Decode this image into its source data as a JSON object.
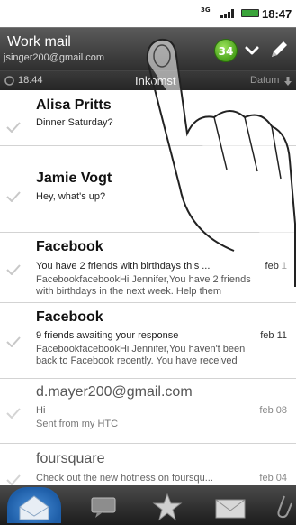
{
  "status_bar": {
    "network": "3G",
    "time": "18:47"
  },
  "header": {
    "account_name": "Work mail",
    "account_email": "jsinger200@gmail.com",
    "unread_count": "34"
  },
  "sortbar": {
    "sync_time": "18:44",
    "folder": "Inkomst",
    "sort_label": "Datum"
  },
  "emails": [
    {
      "sender": "Alisa Pritts",
      "subject": "Dinner Saturday?",
      "preview": "",
      "date": "",
      "read": false
    },
    {
      "sender": "Jamie Vogt",
      "subject": "Hey, what's up?",
      "preview": "",
      "date": "",
      "read": false
    },
    {
      "sender": "Facebook",
      "subject": "You have 2 friends with birthdays this ...",
      "preview": "FacebookfacebookHi Jennifer,You have 2 friends with birthdays in the next week. Help them",
      "date": "feb 1",
      "read": false
    },
    {
      "sender": "Facebook",
      "subject": "9 friends awaiting your response",
      "preview": "FacebookfacebookHi Jennifer,You haven't been back to Facebook recently. You have received",
      "date": "feb 11",
      "read": false
    },
    {
      "sender": "d.mayer200@gmail.com",
      "subject": "Hi",
      "preview": "Sent from my HTC",
      "date": "feb 08",
      "read": true
    },
    {
      "sender": "foursquare",
      "subject": "Check out the new hotness on foursqu...",
      "preview": "",
      "date": "feb 04",
      "read": true
    }
  ],
  "tabs": [
    {
      "name": "tab-inbox",
      "icon": "envelope-open-icon"
    },
    {
      "name": "tab-conversations",
      "icon": "chat-bubbles-icon"
    },
    {
      "name": "tab-favorites",
      "icon": "star-icon"
    },
    {
      "name": "tab-unread",
      "icon": "envelope-icon"
    },
    {
      "name": "tab-more",
      "icon": "paperclip-icon"
    }
  ],
  "colors": {
    "header_bg": "#3f3f3f",
    "badge": "#5cb82a",
    "active_tab": "#2e78c8"
  }
}
